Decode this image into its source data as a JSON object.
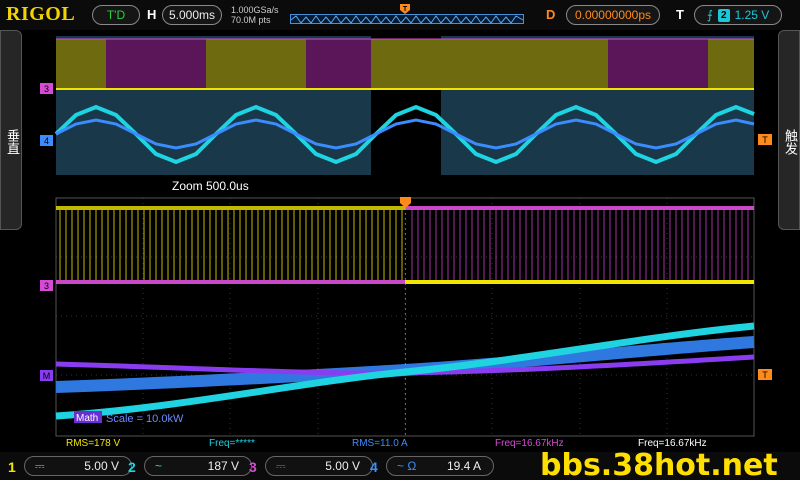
{
  "header": {
    "brand": "RIGOL",
    "run_state": "T'D",
    "horizontal_label": "H",
    "timebase": "5.000ms",
    "sample_rate": "1.000GSa/s",
    "memory_depth": "70.0M pts",
    "delay_label": "D",
    "delay_value": "0.00000000ps",
    "trigger_label": "T",
    "trigger_source": "2",
    "trigger_level": "1.25 V"
  },
  "side_tabs": {
    "left": "垂直",
    "right": "触发"
  },
  "zoom": {
    "label": "Zoom  500.0us"
  },
  "markers": {
    "ch3_top": "3",
    "ch4_top": "4",
    "trig_top": "T",
    "ch3_bottom": "3",
    "math_bottom": "M",
    "trig_bottom": "T"
  },
  "math": {
    "label": "Math",
    "scale": "Scale = 10.0kW"
  },
  "measurements": [
    {
      "text": "RMS=178 V",
      "color": "#f2e600"
    },
    {
      "text": "Freq=*****",
      "color": "#1fd4e0"
    },
    {
      "text": "RMS=11.0 A",
      "color": "#3b8cff"
    },
    {
      "text": "Freq=16.67kHz",
      "color": "#d64bd6"
    },
    {
      "text": "Freq=16.67kHz",
      "color": "#ffffff"
    }
  ],
  "channels": [
    {
      "num": "1",
      "coupling": "⎓",
      "value": "5.00 V",
      "color": "#f2e600"
    },
    {
      "num": "2",
      "coupling": "~",
      "value": "187 V",
      "color": "#1fd4e0"
    },
    {
      "num": "3",
      "coupling": "⎓",
      "value": "5.00 V",
      "color": "#d64bd6"
    },
    {
      "num": "4",
      "coupling": "~ Ω",
      "value": "19.4 A",
      "color": "#3b8cff"
    }
  ],
  "watermark": "bbs.38hot.net",
  "colors": {
    "ch1": "#f2e600",
    "ch2": "#1fd4e0",
    "ch3": "#d64bd6",
    "ch4": "#3b8cff",
    "math": "#8a3df0",
    "trigger": "#ff8a1c"
  }
}
